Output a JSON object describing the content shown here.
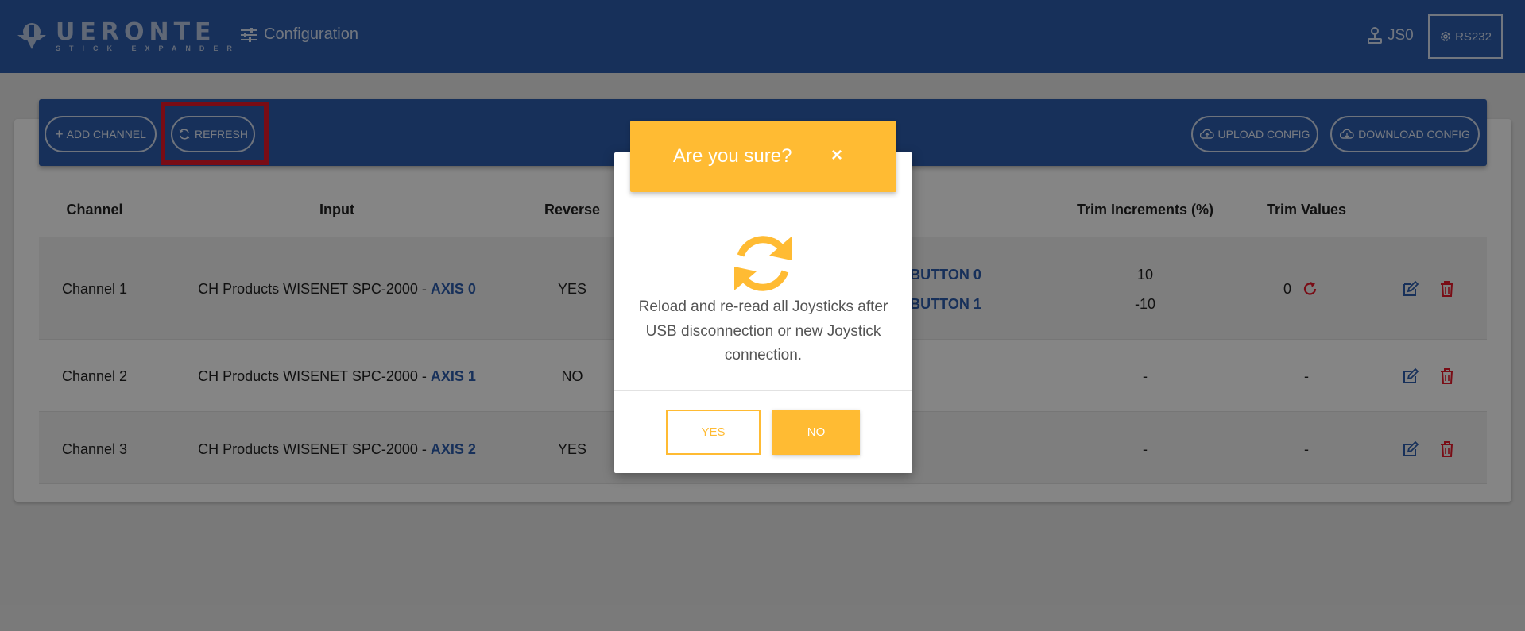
{
  "brand": {
    "name": "UERONTE",
    "subtitle": "STICK EXPANDER",
    "logo_icon": "drone-logo-icon"
  },
  "nav": {
    "config_label": "Configuration",
    "user_label": "JS0",
    "rs232_label": "RS232"
  },
  "toolbar": {
    "add_channel": "ADD CHANNEL",
    "refresh": "REFRESH",
    "upload_config": "UPLOAD CONFIG",
    "download_config": "DOWNLOAD CONFIG"
  },
  "table": {
    "headers": {
      "channel": "Channel",
      "input": "Input",
      "reverse": "Reverse",
      "trim_increments": "Trim Increments (%)",
      "trim_values": "Trim Values"
    },
    "input_separator": " - ",
    "rows": [
      {
        "channel": "Channel 1",
        "input_device": "CH Products WISENET SPC-2000",
        "input_axis": "AXIS 0",
        "reverse": "YES",
        "button_a": "BUTTON 0",
        "button_b": "BUTTON 1",
        "trim_inc_a": "10",
        "trim_inc_b": "-10",
        "trim_value": "0"
      },
      {
        "channel": "Channel 2",
        "input_device": "CH Products WISENET SPC-2000",
        "input_axis": "AXIS 1",
        "reverse": "NO",
        "trim_inc": "-",
        "trim_value": "-"
      },
      {
        "channel": "Channel 3",
        "input_device": "CH Products WISENET SPC-2000",
        "input_axis": "AXIS 2",
        "reverse": "YES",
        "trim_inc": "-",
        "trim_value": "-"
      }
    ]
  },
  "modal": {
    "title": "Are you sure?",
    "close": "×",
    "message": "Reload and re-read all Joysticks after USB disconnection or new Joystick connection.",
    "yes": "YES",
    "no": "NO"
  },
  "colors": {
    "primary": "#2c5dad",
    "warning": "#ffbb33",
    "danger": "#e8182a",
    "highlight": "#e8182a"
  }
}
